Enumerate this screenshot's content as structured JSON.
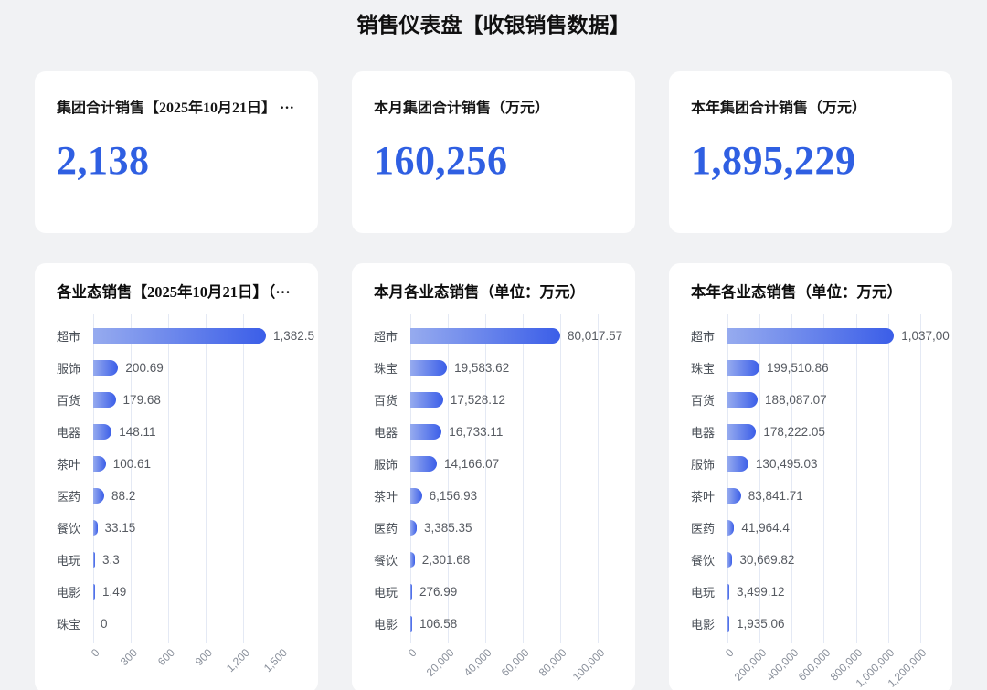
{
  "page_title": "销售仪表盘【收银销售数据】",
  "colors": {
    "background": "#f1f2f4",
    "card": "#ffffff",
    "kpi_number": "#2f5fe2",
    "bar_gradient_start": "#96abef",
    "bar_gradient_end": "#3b5ee8",
    "gridline": "#e4e9f4",
    "category_label": "#474d55",
    "value_label": "#565a61",
    "tick_label": "#8a909b"
  },
  "kpi_cards": [
    {
      "title": "集团合计销售【2025年10月21日】 ···",
      "value": "2,138"
    },
    {
      "title": "本月集团合计销售（万元）",
      "value": "160,256"
    },
    {
      "title": "本年集团合计销售（万元）",
      "value": "1,895,229"
    }
  ],
  "chart_data": [
    {
      "type": "bar",
      "orientation": "horizontal",
      "title": "各业态销售【2025年10月21日】（···",
      "categories": [
        "超市",
        "服饰",
        "百货",
        "电器",
        "茶叶",
        "医药",
        "餐饮",
        "电玩",
        "电影",
        "珠宝"
      ],
      "values": [
        1382.5,
        200.69,
        179.68,
        148.11,
        100.61,
        88.2,
        33.15,
        3.3,
        1.49,
        0
      ],
      "value_labels": [
        "1,382.5",
        "200.69",
        "179.68",
        "148.11",
        "100.61",
        "88.2",
        "33.15",
        "3.3",
        "1.49",
        "0"
      ],
      "x_ticks": [
        "0",
        "300",
        "600",
        "900",
        "1,200",
        "1,500"
      ],
      "xlim": [
        0,
        1800
      ],
      "axis_max": 1800,
      "gridline_count": 7,
      "grid": true,
      "legend": "none"
    },
    {
      "type": "bar",
      "orientation": "horizontal",
      "title": "本月各业态销售（单位：万元）",
      "categories": [
        "超市",
        "珠宝",
        "百货",
        "电器",
        "服饰",
        "茶叶",
        "医药",
        "餐饮",
        "电玩",
        "电影"
      ],
      "values": [
        80017.57,
        19583.62,
        17528.12,
        16733.11,
        14166.07,
        6156.93,
        3385.35,
        2301.68,
        276.99,
        106.58
      ],
      "value_labels": [
        "80,017.57",
        "19,583.62",
        "17,528.12",
        "16,733.11",
        "14,166.07",
        "6,156.93",
        "3,385.35",
        "2,301.68",
        "276.99",
        "106.58"
      ],
      "x_ticks": [
        "0",
        "20,000",
        "40,000",
        "60,000",
        "80,000",
        "100,000"
      ],
      "xlim": [
        0,
        120000
      ],
      "axis_max": 120000,
      "gridline_count": 7,
      "grid": true,
      "legend": "none"
    },
    {
      "type": "bar",
      "orientation": "horizontal",
      "title": "本年各业态销售（单位：万元）",
      "categories": [
        "超市",
        "珠宝",
        "百货",
        "电器",
        "服饰",
        "茶叶",
        "医药",
        "餐饮",
        "电玩",
        "电影"
      ],
      "values": [
        1037000,
        199510.86,
        188087.07,
        178222.05,
        130495.03,
        83841.71,
        41964.4,
        30669.82,
        3499.12,
        1935.06
      ],
      "value_labels": [
        "1,037,00",
        "199,510.86",
        "188,087.07",
        "178,222.05",
        "130,495.03",
        "83,841.71",
        "41,964.4",
        "30,669.82",
        "3,499.12",
        "1,935.06"
      ],
      "x_ticks": [
        "0",
        "200,000",
        "400,000",
        "600,000",
        "800,000",
        "1,000,000",
        "1,200,000"
      ],
      "xlim": [
        0,
        1400000
      ],
      "axis_max": 1400000,
      "gridline_count": 8,
      "grid": true,
      "legend": "none"
    }
  ]
}
